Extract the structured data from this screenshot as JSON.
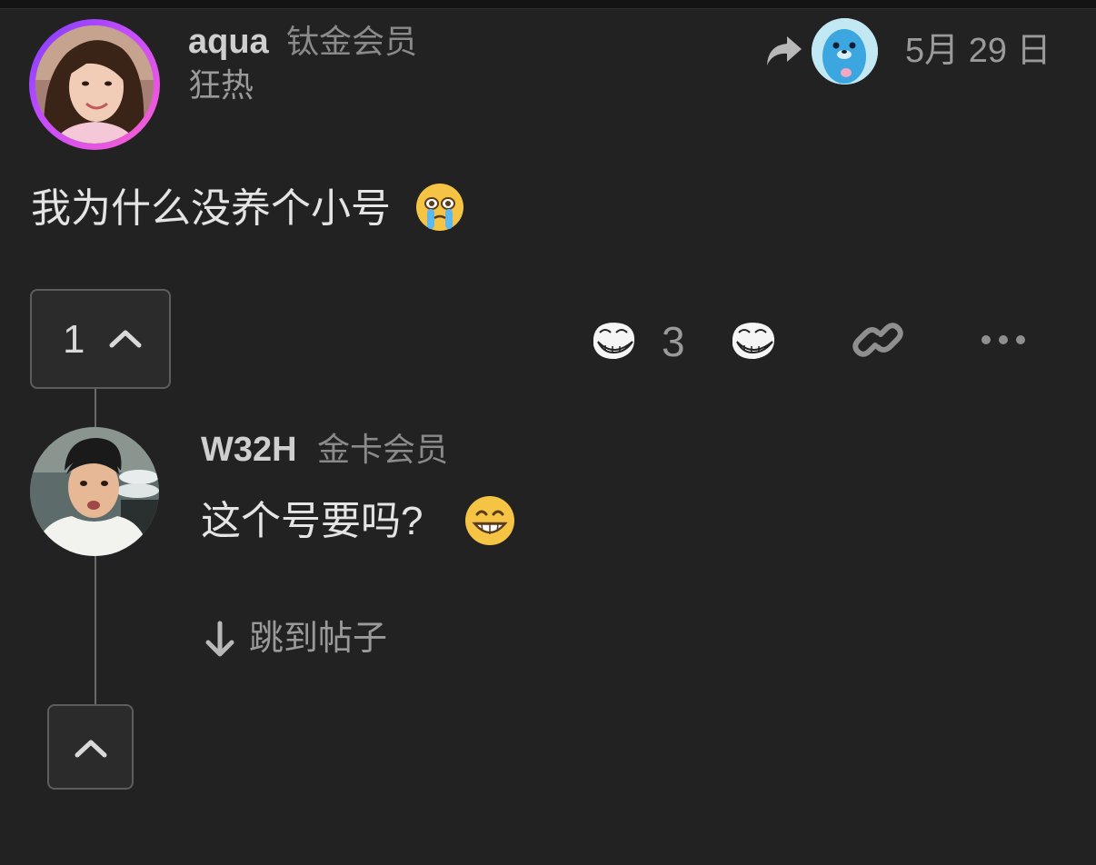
{
  "post": {
    "author": {
      "username": "aqua",
      "member_tier": "钛金会员",
      "flair": "狂热",
      "avatar": "avatar-photo"
    },
    "reply_to_avatar": "blue-seal-avatar",
    "date": "5月 29 日",
    "body_text": "我为什么没养个小号",
    "body_emoji": "crying-face-emoji",
    "votes": {
      "count": "1"
    },
    "actions": {
      "reaction_count": "3",
      "reaction_icon": "trollface-icon",
      "link_icon": "link-icon",
      "more_icon": "more-icon"
    }
  },
  "reply": {
    "author": {
      "username": "W32H",
      "member_tier": "金卡会员",
      "avatar": "avatar-photo"
    },
    "body_text": "这个号要吗?",
    "body_emoji": "grinning-face-emoji",
    "jump_label": "跳到帖子"
  },
  "colors": {
    "background": "#222222",
    "text": "#e4e4e4",
    "muted": "#9a9a9a",
    "avatar_ring": "#c74dff"
  }
}
